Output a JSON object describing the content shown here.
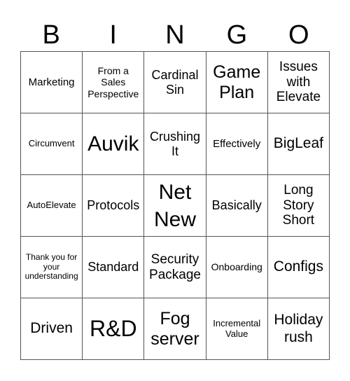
{
  "header": {
    "letters": [
      "B",
      "I",
      "N",
      "G",
      "O"
    ]
  },
  "cells": [
    [
      "Marketing",
      "From a Sales Perspective",
      "Cardinal Sin",
      "Game Plan",
      "Issues with Elevate"
    ],
    [
      "Circumvent",
      "Auvik",
      "Crushing It",
      "Effectively",
      "BigLeaf"
    ],
    [
      "AutoElevate",
      "Protocols",
      "Net New",
      "Basically",
      "Long Story Short"
    ],
    [
      "Thank you for your understanding",
      "Standard",
      "Security Package",
      "Onboarding",
      "Configs"
    ],
    [
      "Driven",
      "R&D",
      "Fog server",
      "Incremental Value",
      "Holiday rush"
    ]
  ]
}
